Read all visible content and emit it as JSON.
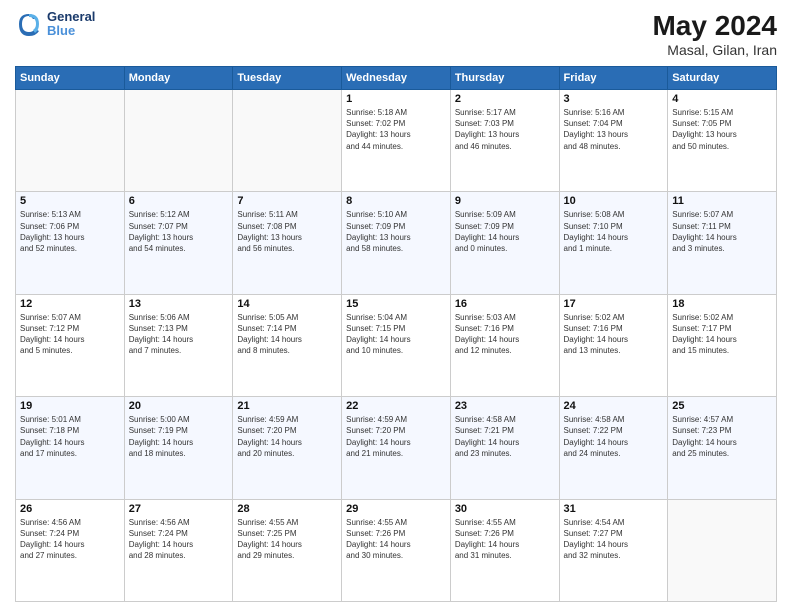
{
  "header": {
    "logo_line1": "General",
    "logo_line2": "Blue",
    "month_year": "May 2024",
    "location": "Masal, Gilan, Iran"
  },
  "weekdays": [
    "Sunday",
    "Monday",
    "Tuesday",
    "Wednesday",
    "Thursday",
    "Friday",
    "Saturday"
  ],
  "weeks": [
    [
      {
        "day": "",
        "info": ""
      },
      {
        "day": "",
        "info": ""
      },
      {
        "day": "",
        "info": ""
      },
      {
        "day": "1",
        "info": "Sunrise: 5:18 AM\nSunset: 7:02 PM\nDaylight: 13 hours\nand 44 minutes."
      },
      {
        "day": "2",
        "info": "Sunrise: 5:17 AM\nSunset: 7:03 PM\nDaylight: 13 hours\nand 46 minutes."
      },
      {
        "day": "3",
        "info": "Sunrise: 5:16 AM\nSunset: 7:04 PM\nDaylight: 13 hours\nand 48 minutes."
      },
      {
        "day": "4",
        "info": "Sunrise: 5:15 AM\nSunset: 7:05 PM\nDaylight: 13 hours\nand 50 minutes."
      }
    ],
    [
      {
        "day": "5",
        "info": "Sunrise: 5:13 AM\nSunset: 7:06 PM\nDaylight: 13 hours\nand 52 minutes."
      },
      {
        "day": "6",
        "info": "Sunrise: 5:12 AM\nSunset: 7:07 PM\nDaylight: 13 hours\nand 54 minutes."
      },
      {
        "day": "7",
        "info": "Sunrise: 5:11 AM\nSunset: 7:08 PM\nDaylight: 13 hours\nand 56 minutes."
      },
      {
        "day": "8",
        "info": "Sunrise: 5:10 AM\nSunset: 7:09 PM\nDaylight: 13 hours\nand 58 minutes."
      },
      {
        "day": "9",
        "info": "Sunrise: 5:09 AM\nSunset: 7:09 PM\nDaylight: 14 hours\nand 0 minutes."
      },
      {
        "day": "10",
        "info": "Sunrise: 5:08 AM\nSunset: 7:10 PM\nDaylight: 14 hours\nand 1 minute."
      },
      {
        "day": "11",
        "info": "Sunrise: 5:07 AM\nSunset: 7:11 PM\nDaylight: 14 hours\nand 3 minutes."
      }
    ],
    [
      {
        "day": "12",
        "info": "Sunrise: 5:07 AM\nSunset: 7:12 PM\nDaylight: 14 hours\nand 5 minutes."
      },
      {
        "day": "13",
        "info": "Sunrise: 5:06 AM\nSunset: 7:13 PM\nDaylight: 14 hours\nand 7 minutes."
      },
      {
        "day": "14",
        "info": "Sunrise: 5:05 AM\nSunset: 7:14 PM\nDaylight: 14 hours\nand 8 minutes."
      },
      {
        "day": "15",
        "info": "Sunrise: 5:04 AM\nSunset: 7:15 PM\nDaylight: 14 hours\nand 10 minutes."
      },
      {
        "day": "16",
        "info": "Sunrise: 5:03 AM\nSunset: 7:16 PM\nDaylight: 14 hours\nand 12 minutes."
      },
      {
        "day": "17",
        "info": "Sunrise: 5:02 AM\nSunset: 7:16 PM\nDaylight: 14 hours\nand 13 minutes."
      },
      {
        "day": "18",
        "info": "Sunrise: 5:02 AM\nSunset: 7:17 PM\nDaylight: 14 hours\nand 15 minutes."
      }
    ],
    [
      {
        "day": "19",
        "info": "Sunrise: 5:01 AM\nSunset: 7:18 PM\nDaylight: 14 hours\nand 17 minutes."
      },
      {
        "day": "20",
        "info": "Sunrise: 5:00 AM\nSunset: 7:19 PM\nDaylight: 14 hours\nand 18 minutes."
      },
      {
        "day": "21",
        "info": "Sunrise: 4:59 AM\nSunset: 7:20 PM\nDaylight: 14 hours\nand 20 minutes."
      },
      {
        "day": "22",
        "info": "Sunrise: 4:59 AM\nSunset: 7:20 PM\nDaylight: 14 hours\nand 21 minutes."
      },
      {
        "day": "23",
        "info": "Sunrise: 4:58 AM\nSunset: 7:21 PM\nDaylight: 14 hours\nand 23 minutes."
      },
      {
        "day": "24",
        "info": "Sunrise: 4:58 AM\nSunset: 7:22 PM\nDaylight: 14 hours\nand 24 minutes."
      },
      {
        "day": "25",
        "info": "Sunrise: 4:57 AM\nSunset: 7:23 PM\nDaylight: 14 hours\nand 25 minutes."
      }
    ],
    [
      {
        "day": "26",
        "info": "Sunrise: 4:56 AM\nSunset: 7:24 PM\nDaylight: 14 hours\nand 27 minutes."
      },
      {
        "day": "27",
        "info": "Sunrise: 4:56 AM\nSunset: 7:24 PM\nDaylight: 14 hours\nand 28 minutes."
      },
      {
        "day": "28",
        "info": "Sunrise: 4:55 AM\nSunset: 7:25 PM\nDaylight: 14 hours\nand 29 minutes."
      },
      {
        "day": "29",
        "info": "Sunrise: 4:55 AM\nSunset: 7:26 PM\nDaylight: 14 hours\nand 30 minutes."
      },
      {
        "day": "30",
        "info": "Sunrise: 4:55 AM\nSunset: 7:26 PM\nDaylight: 14 hours\nand 31 minutes."
      },
      {
        "day": "31",
        "info": "Sunrise: 4:54 AM\nSunset: 7:27 PM\nDaylight: 14 hours\nand 32 minutes."
      },
      {
        "day": "",
        "info": ""
      }
    ]
  ]
}
